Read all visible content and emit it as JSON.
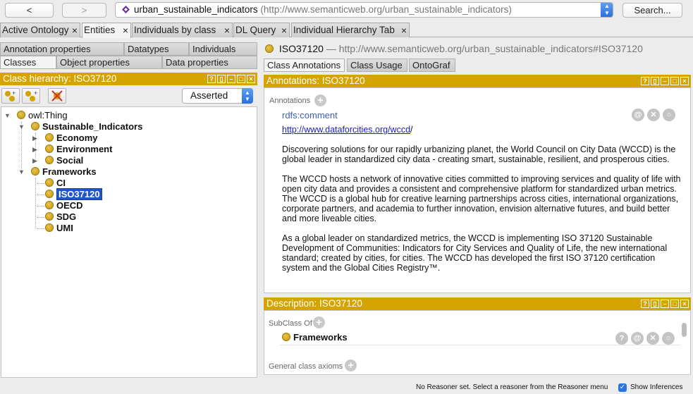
{
  "toolbar": {
    "back_label": "<",
    "forward_label": ">",
    "ontology_name": "urban_sustainable_indicators",
    "ontology_iri": "(http://www.semanticweb.org/urban_sustainable_indicators)",
    "search_label": "Search..."
  },
  "main_tabs": [
    {
      "label": "Active Ontology"
    },
    {
      "label": "Entities"
    },
    {
      "label": "Individuals by class"
    },
    {
      "label": "DL Query"
    },
    {
      "label": "Individual Hierarchy Tab"
    }
  ],
  "tab_close_glyph": "×",
  "left": {
    "subtabs_top": [
      "Annotation properties",
      "Datatypes",
      "Individuals"
    ],
    "subtabs_bottom": [
      "Classes",
      "Object properties",
      "Data properties"
    ],
    "hierarchy_title": "Class hierarchy: ISO37120",
    "mode_selected": "Asserted",
    "tree": {
      "root": "owl:Thing",
      "sustainable": "Sustainable_Indicators",
      "economy": "Economy",
      "environment": "Environment",
      "social": "Social",
      "frameworks": "Frameworks",
      "ci": "CI",
      "iso": "ISO37120",
      "oecd": "OECD",
      "sdg": "SDG",
      "umi": "UMI"
    }
  },
  "right": {
    "entity_name": "ISO37120",
    "entity_iri": "— http://www.semanticweb.org/urban_sustainable_indicators#ISO37120",
    "tabs": [
      "Class Annotations",
      "Class Usage",
      "OntoGraf"
    ],
    "annotations_title": "Annotations: ISO37120",
    "annotations_label": "Annotations",
    "annotation_property": "rdfs:comment",
    "annotation_link": "http://www.dataforcities.org/wccd",
    "annotation_link_suffix": "/",
    "paragraph1": "Discovering solutions for our rapidly urbanizing planet, the World Council on City Data (WCCD) is the global leader in standardized city data - creating smart, sustainable, resilient, and prosperous cities.",
    "paragraph2": "The WCCD hosts a network of innovative cities committed to improving services and quality of life with open city data and provides a consistent and comprehensive platform for standardized urban metrics. The WCCD is a global hub for creative learning partnerships across cities, international organizations, corporate partners, and academia to further innovation, envision alternative futures, and build better and more liveable cities.",
    "paragraph3": "As a global leader on standardized metrics, the WCCD is implementing ISO 37120 Sustainable Development of Communities: Indicators for City Services and Quality of Life, the new international standard; created by cities, for cities. The WCCD has developed the first ISO 37120 certification system and the Global Cities Registry™.",
    "description_title": "Description: ISO37120",
    "subclass_label": "SubClass Of",
    "subclass_value": "Frameworks",
    "general_axioms_label": "General class axioms"
  },
  "status": {
    "reasoner_text": "No Reasoner set. Select a reasoner from the Reasoner menu",
    "show_inferences": "Show Inferences"
  },
  "colors": {
    "accent_gold": "#d6a400",
    "selection_blue": "#2056c9"
  }
}
